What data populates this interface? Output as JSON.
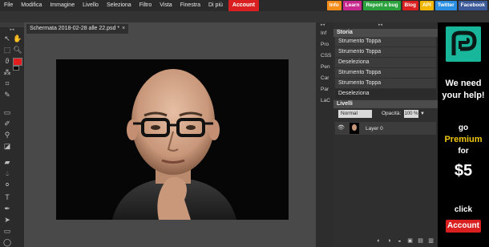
{
  "menubar": {
    "items": [
      "File",
      "Modifica",
      "Immagine",
      "Livello",
      "Seleziona",
      "Filtro",
      "Vista",
      "Finestra",
      "Di più"
    ],
    "account": "Account",
    "right": [
      {
        "label": "Info",
        "color": "#f28c1b"
      },
      {
        "label": "Learn",
        "color": "#c7298e"
      },
      {
        "label": "Report a bug",
        "color": "#2aa13c"
      },
      {
        "label": "Blog",
        "color": "#d91f1f"
      },
      {
        "label": "API",
        "color": "#f2b705"
      },
      {
        "label": "Twitter",
        "color": "#2b8ee0"
      },
      {
        "label": "Facebook",
        "color": "#3d5a98"
      }
    ]
  },
  "document": {
    "tab_title": "Schermata 2018-02-28 alle 22.psd *",
    "close": "×"
  },
  "strip": [
    "Inf",
    "Pro",
    "CSS",
    "Pen",
    "Car",
    "Par",
    "LaC"
  ],
  "history": {
    "title": "Storia",
    "items": [
      "Strumento Toppa",
      "Strumento Toppa",
      "Deseleziona",
      "Strumento Toppa",
      "Strumento Toppa",
      "Deseleziona"
    ]
  },
  "layers": {
    "title": "Livelli",
    "blend_mode": "Normal",
    "opacity_label": "Opacità:",
    "opacity_value": "100 %",
    "layer_name": "Layer 0"
  },
  "ad": {
    "line1": "We need",
    "line2": "your help!",
    "line3": "go",
    "line4": "Premium",
    "line5": "for",
    "price": "$5",
    "line6": "click",
    "button": "Account",
    "accent": "#f2c80f"
  },
  "colors": {
    "foreground": "#e21d1d",
    "background": "#000000"
  }
}
